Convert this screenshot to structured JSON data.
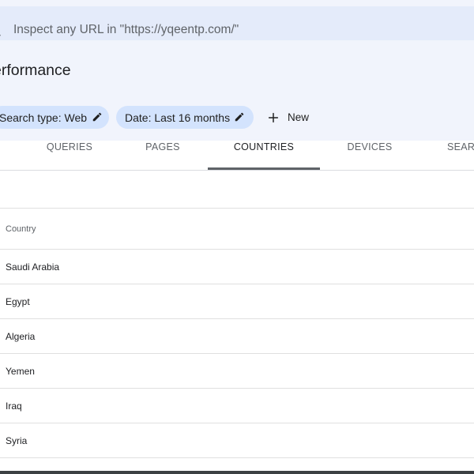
{
  "search": {
    "placeholder": "Inspect any URL in \"https://yqeentp.com/\""
  },
  "page": {
    "title": "erformance"
  },
  "filters": {
    "search_type_label": "Search type: Web",
    "date_label": "Date: Last 16 months",
    "new_label": "New"
  },
  "tabs": [
    {
      "label": "QUERIES"
    },
    {
      "label": "PAGES"
    },
    {
      "label": "COUNTRIES"
    },
    {
      "label": "DEVICES"
    },
    {
      "label": "SEAR"
    }
  ],
  "active_tab": "COUNTRIES",
  "table": {
    "header": "Country",
    "rows": [
      {
        "country": "Saudi Arabia"
      },
      {
        "country": "Egypt"
      },
      {
        "country": "Algeria"
      },
      {
        "country": "Yemen"
      },
      {
        "country": "Iraq"
      },
      {
        "country": "Syria"
      }
    ]
  },
  "colors": {
    "search_bg": "#e4ebfa",
    "chip_bg": "#d3e3fd",
    "header_bg": "#f1f4fc"
  }
}
